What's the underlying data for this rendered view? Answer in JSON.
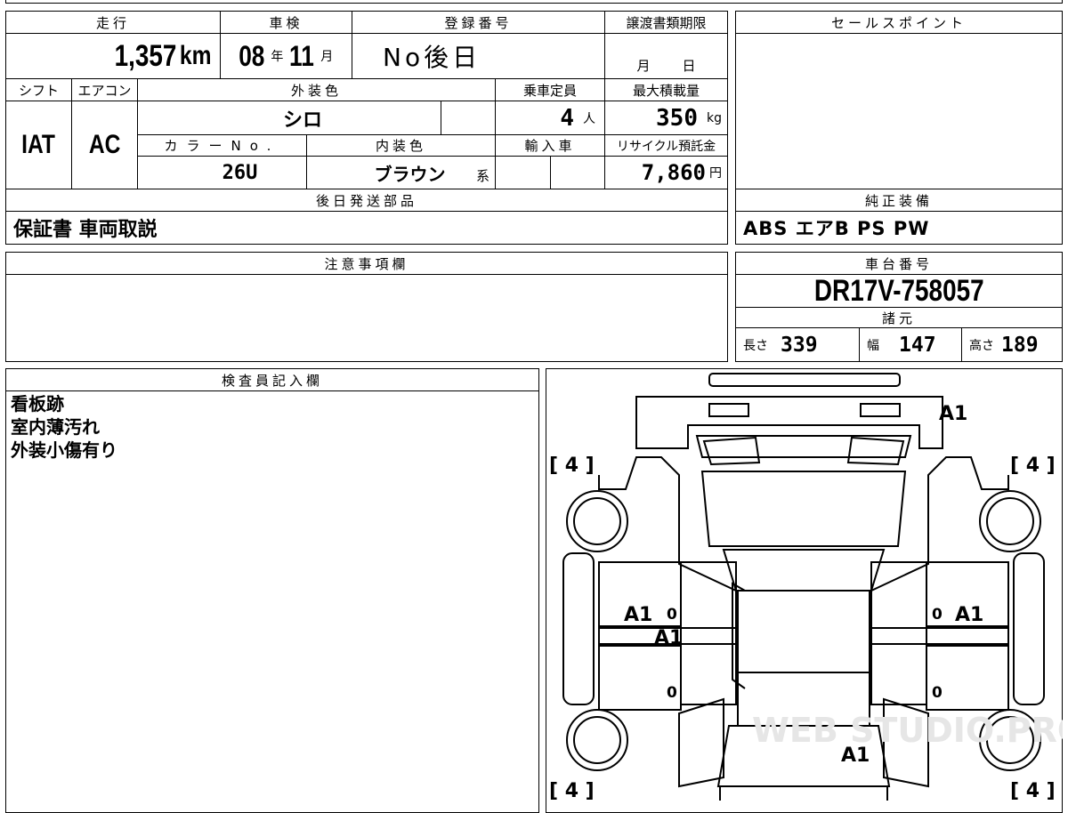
{
  "vehicle": {
    "mileage_label": "走行",
    "mileage": "1,357",
    "mileage_unit": "km",
    "inspection_label": "車検",
    "inspection_year": "08",
    "inspection_year_unit": "年",
    "inspection_month": "11",
    "inspection_month_unit": "月",
    "registration_label": "登録番号",
    "registration": "No後日",
    "transfer_label": "譲渡書類期限",
    "transfer_month_unit": "月",
    "transfer_day_unit": "日",
    "shift_label": "シフト",
    "shift": "IAT",
    "ac_label": "エアコン",
    "ac": "AC",
    "exterior_color_label": "外装色",
    "exterior_color": "シロ",
    "seating_label": "乗車定員",
    "seating": "4",
    "seating_unit": "人",
    "max_load_label": "最大積載量",
    "max_load": "350",
    "max_load_unit": "kg",
    "color_no_label": "カラーNo.",
    "color_no": "26U",
    "interior_color_label": "内装色",
    "interior_color": "ブラウン",
    "interior_color_suffix": "系",
    "import_label": "輸入車",
    "recycle_label": "リサイクル預託金",
    "recycle_fee": "7,860",
    "recycle_unit": "円",
    "later_parts_label": "後日発送部品",
    "later_parts": "保証書 車両取説"
  },
  "sales_point": {
    "label": "セールスポイント",
    "text": ""
  },
  "equipment": {
    "label": "純正装備",
    "value": "ABS エアB PS PW"
  },
  "notes": {
    "label": "注意事項欄",
    "text": ""
  },
  "chassis": {
    "label": "車台番号",
    "value": "DR17V-758057",
    "specs_label": "諸元",
    "length_label": "長さ",
    "length": "339",
    "width_label": "幅",
    "width": "147",
    "height_label": "高さ",
    "height": "189"
  },
  "inspector": {
    "label": "検査員記入欄",
    "lines": [
      "看板跡",
      "室内薄汚れ",
      "外装小傷有り"
    ]
  },
  "diagram": {
    "tire_marks": [
      "[ 4 ]",
      "[ 4 ]",
      "[ 4 ]",
      "[ 4 ]"
    ],
    "damage_codes": [
      "A1",
      "A1",
      "A1",
      "A1",
      "A1"
    ],
    "zero_marks": [
      "0",
      "0",
      "0",
      "0"
    ],
    "watermark": "WEB STUDIO.PRO"
  }
}
